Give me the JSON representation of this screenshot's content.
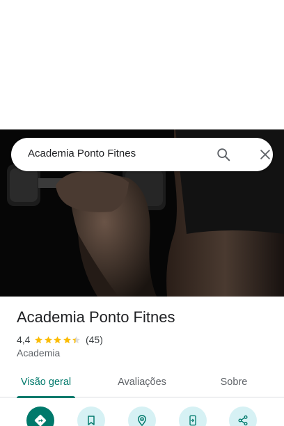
{
  "search": {
    "query": "Academia Ponto Fitnes"
  },
  "place": {
    "title": "Academia Ponto Fitnes",
    "rating": "4,4",
    "stars": 4.4,
    "review_count": "(45)",
    "category": "Academia"
  },
  "tabs": [
    {
      "label": "Visão geral",
      "active": true
    },
    {
      "label": "Avaliações",
      "active": false
    },
    {
      "label": "Sobre",
      "active": false
    }
  ],
  "actions": [
    {
      "icon": "directions-icon"
    },
    {
      "icon": "bookmark-icon"
    },
    {
      "icon": "nearby-icon"
    },
    {
      "icon": "send-to-phone-icon"
    },
    {
      "icon": "share-icon"
    }
  ],
  "colors": {
    "accent": "#00796b",
    "action_bg": "#d6f1f4",
    "star": "#fbbc04"
  }
}
